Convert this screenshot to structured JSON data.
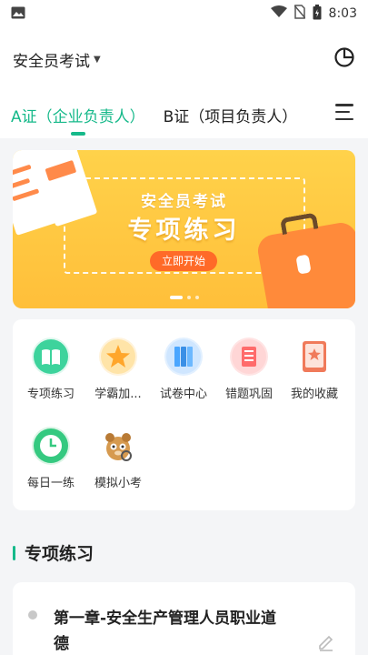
{
  "status_bar": {
    "time": "8:03",
    "icons": [
      "image-icon",
      "wifi-icon",
      "no-sim-icon",
      "battery-icon"
    ]
  },
  "header": {
    "title": "安全员考试",
    "icons": [
      "chevron-down-icon",
      "pie-chart-icon"
    ]
  },
  "tabs": [
    {
      "label": "A证（企业负责人）",
      "active": true
    },
    {
      "label": "B证（项目负责人）",
      "active": false
    }
  ],
  "banner": {
    "subtitle": "安全员考试",
    "title": "专项练习",
    "button": "立即开始",
    "slides": 3,
    "active_slide": 1
  },
  "grid": [
    {
      "label": "专项练习",
      "icon": "book-icon",
      "color": "#3dd39c"
    },
    {
      "label": "学霸加...",
      "icon": "star-icon",
      "color": "#ffb030"
    },
    {
      "label": "试卷中心",
      "icon": "papers-icon",
      "color": "#4aa6ff"
    },
    {
      "label": "错题巩固",
      "icon": "error-list-icon",
      "color": "#ff6b6b"
    },
    {
      "label": "我的收藏",
      "icon": "bookmark-icon",
      "color": "#e8664e"
    },
    {
      "label": "每日一练",
      "icon": "clock-icon",
      "color": "#35c980"
    },
    {
      "label": "模拟小考",
      "icon": "mascot-icon",
      "color": "#c9893a"
    }
  ],
  "section": {
    "title": "专项练习"
  },
  "chapters": [
    {
      "title": "第一章-安全生产管理人员职业道德",
      "icon": "edit-icon"
    }
  ],
  "colors": {
    "accent": "#16b98a",
    "banner": "#ffc83f",
    "button": "#ff6a28"
  }
}
